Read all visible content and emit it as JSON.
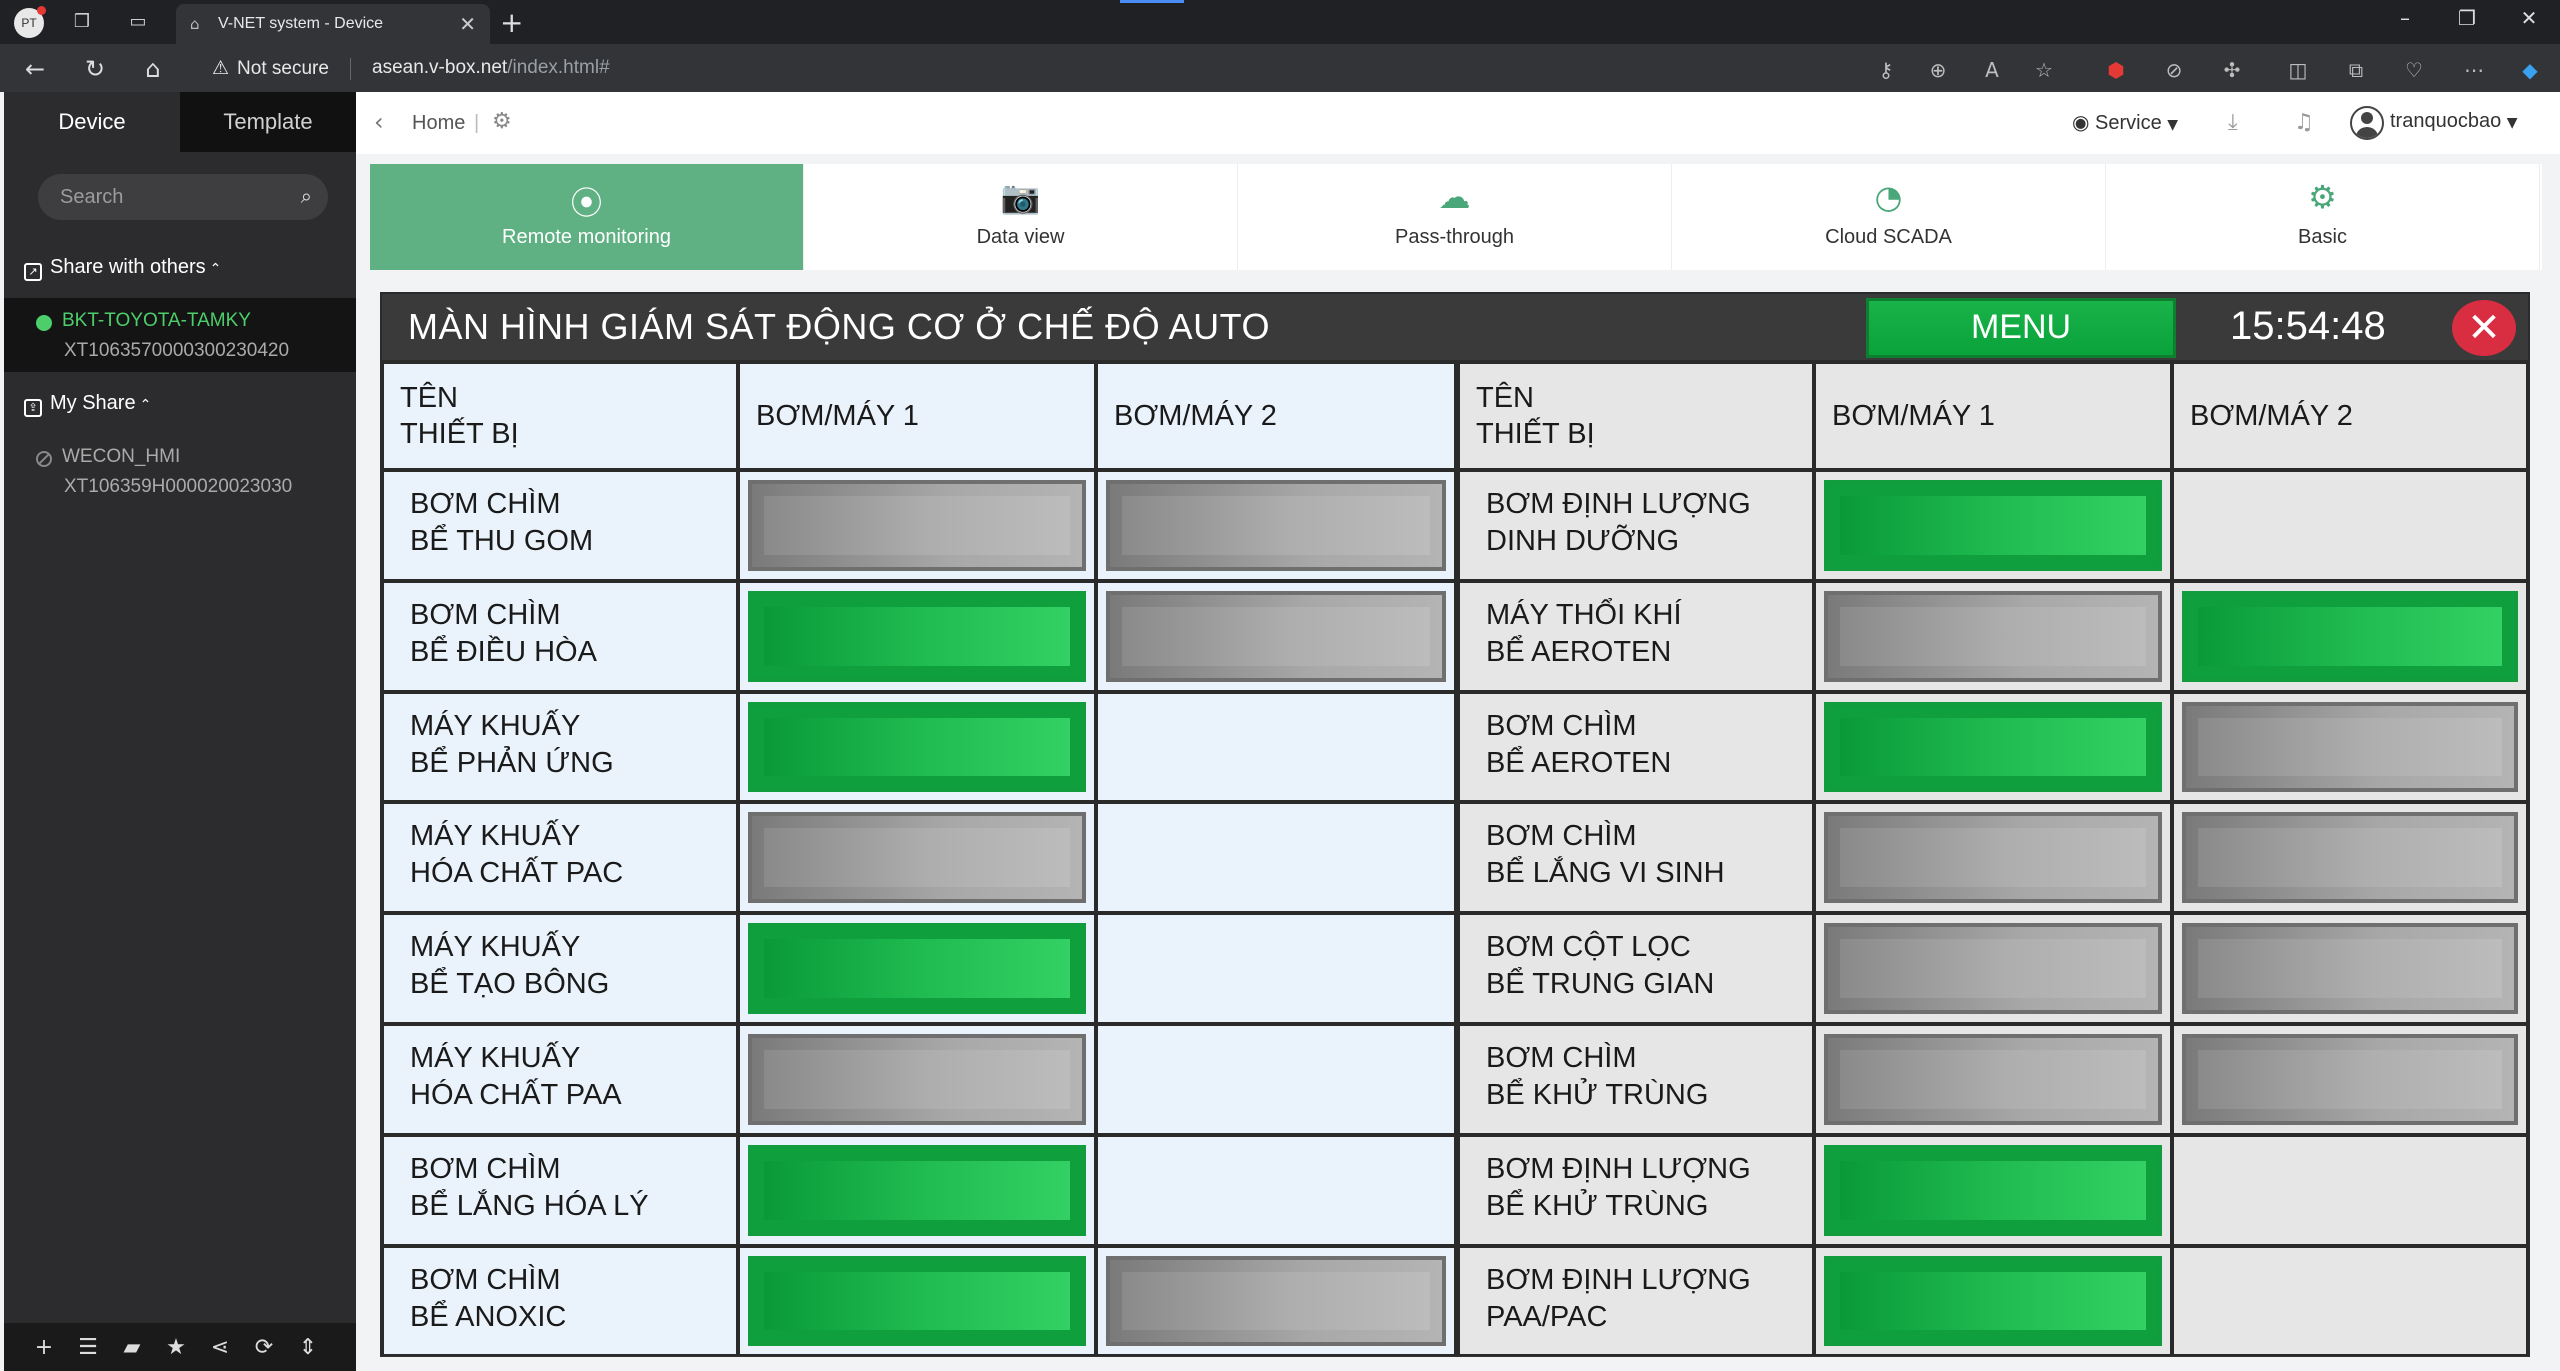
{
  "browser": {
    "profile_initials": "PT",
    "tab_title": "V-NET system - Device",
    "security_label": "Not secure",
    "url_host": "asean.v-box.net",
    "url_path": "/index.html#"
  },
  "sidebar": {
    "tabs": [
      "Device",
      "Template"
    ],
    "search_placeholder": "Search",
    "share_with_others_label": "Share with others",
    "my_share_label": "My Share",
    "devices": [
      {
        "name": "BKT-TOYOTA-TAMKY",
        "serial": "XT1063570000300230420",
        "status": "online"
      },
      {
        "name": "WECON_HMI",
        "serial": "XT106359H000020023030",
        "status": "offline"
      }
    ]
  },
  "header": {
    "breadcrumb_home": "Home",
    "breadcrumb_sep": "|",
    "service_label": "Service",
    "username": "tranquocbao"
  },
  "function_tabs": [
    {
      "label": "Remote monitoring",
      "icon": "broadcast-icon",
      "active": true
    },
    {
      "label": "Data view",
      "icon": "camera-icon",
      "active": false
    },
    {
      "label": "Pass-through",
      "icon": "cloud-download-icon",
      "active": false
    },
    {
      "label": "Cloud SCADA",
      "icon": "dashboard-icon",
      "active": false
    },
    {
      "label": "Basic",
      "icon": "gears-icon",
      "active": false
    }
  ],
  "hmi": {
    "title": "MÀN HÌNH GIÁM SÁT ĐỘNG CƠ Ở CHẾ ĐỘ AUTO",
    "menu_label": "MENU",
    "clock": "15:54:48",
    "colors": {
      "on": "#1fb84f",
      "off": "#a0a0a0",
      "left_bg": "#eaf2fb",
      "right_bg": "#e6e6e6"
    },
    "left_table": {
      "headers": [
        "TÊN\nTHIẾT BỊ",
        "BƠM/MÁY 1",
        "BƠM/MÁY 2"
      ],
      "rows": [
        {
          "line1": "BƠM CHÌM",
          "line2": "BỂ THU GOM",
          "m1": "off",
          "m2": "off"
        },
        {
          "line1": "BƠM CHÌM",
          "line2": "BỂ ĐIỀU HÒA",
          "m1": "on",
          "m2": "off"
        },
        {
          "line1": "MÁY KHUẤY",
          "line2": "BỂ PHẢN ỨNG",
          "m1": "on",
          "m2": "none"
        },
        {
          "line1": "MÁY KHUẤY",
          "line2": "HÓA CHẤT PAC",
          "m1": "off",
          "m2": "none"
        },
        {
          "line1": "MÁY KHUẤY",
          "line2": "BỂ TẠO BÔNG",
          "m1": "on",
          "m2": "none"
        },
        {
          "line1": "MÁY KHUẤY",
          "line2": "HÓA CHẤT PAA",
          "m1": "off",
          "m2": "none"
        },
        {
          "line1": "BƠM CHÌM",
          "line2": "BỂ LẮNG HÓA LÝ",
          "m1": "on",
          "m2": "none"
        },
        {
          "line1": "BƠM CHÌM",
          "line2": "BỂ ANOXIC",
          "m1": "on",
          "m2": "off"
        }
      ]
    },
    "right_table": {
      "headers": [
        "TÊN\nTHIẾT BỊ",
        "BƠM/MÁY 1",
        "BƠM/MÁY 2"
      ],
      "rows": [
        {
          "line1": "BƠM ĐỊNH LƯỢNG",
          "line2": "DINH DƯỠNG",
          "m1": "on",
          "m2": "none"
        },
        {
          "line1": "MÁY THỔI KHÍ",
          "line2": "BỂ AEROTEN",
          "m1": "off",
          "m2": "on"
        },
        {
          "line1": "BƠM CHÌM",
          "line2": "BỂ AEROTEN",
          "m1": "on",
          "m2": "off"
        },
        {
          "line1": "BƠM CHÌM",
          "line2": "BỂ LẮNG VI SINH",
          "m1": "off",
          "m2": "off"
        },
        {
          "line1": "BƠM CỘT LỌC",
          "line2": "BỂ TRUNG GIAN",
          "m1": "off",
          "m2": "off"
        },
        {
          "line1": "BƠM CHÌM",
          "line2": "BỂ KHỬ TRÙNG",
          "m1": "off",
          "m2": "off"
        },
        {
          "line1": "BƠM ĐỊNH LƯỢNG",
          "line2": "BỂ KHỬ TRÙNG",
          "m1": "on",
          "m2": "none"
        },
        {
          "line1": "BƠM ĐỊNH LƯỢNG",
          "line2": "PAA/PAC",
          "m1": "on",
          "m2": "none"
        }
      ]
    }
  }
}
